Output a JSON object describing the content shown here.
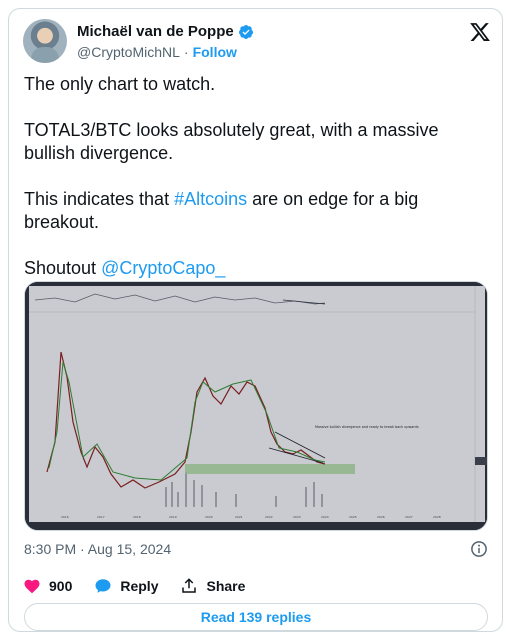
{
  "author": {
    "name": "Michaël van de Poppe",
    "handle": "@CryptoMichNL",
    "separator": "·",
    "follow_label": "Follow"
  },
  "tweet": {
    "paragraph_1": "The only chart to watch.",
    "paragraph_2": "TOTAL3/BTC looks absolutely great, with a massive bullish divergence.",
    "paragraph_3_before": "This indicates that ",
    "paragraph_3_hashtag": "#Altcoins",
    "paragraph_3_after": " are on edge for a big breakout.",
    "paragraph_4_before": "Shoutout ",
    "paragraph_4_mention": "@CryptoCapo_"
  },
  "media": {
    "chart_annotation": "Massive bullish divergence and ready to break back upwards",
    "x_axis_ticks": [
      "2016",
      "2017",
      "2018",
      "2019",
      "2020",
      "2021",
      "2022",
      "2023",
      "2024",
      "2025",
      "2026",
      "2027",
      "2028"
    ]
  },
  "meta": {
    "timestamp": "8:30 PM · Aug 15, 2024"
  },
  "actions": {
    "likes": "900",
    "reply_label": "Reply",
    "share_label": "Share",
    "read_replies": "Read 139 replies"
  },
  "colors": {
    "accent": "#1d9bf0",
    "like": "#f91880",
    "text_secondary": "#536471",
    "border": "#cfd9de"
  },
  "icons": [
    "verified-badge-icon",
    "x-logo-icon",
    "info-icon",
    "heart-icon",
    "reply-bubble-icon",
    "share-icon"
  ]
}
